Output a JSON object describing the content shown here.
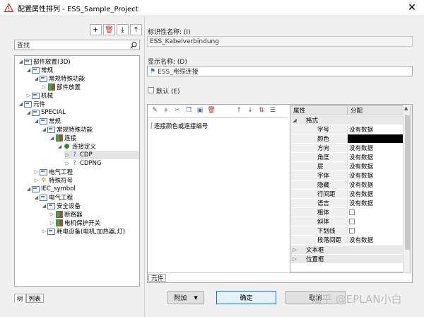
{
  "window": {
    "title": "配置属性排列 - ESS_Sample_Project",
    "close_glyph": "✕"
  },
  "left": {
    "search_placeholder": "查找",
    "tree": [
      {
        "label": "部件放置(3D)"
      },
      {
        "label": "常规"
      },
      {
        "label": "常规特殊功能"
      },
      {
        "label": "部件放置"
      },
      {
        "label": "机械"
      },
      {
        "label": "元件"
      },
      {
        "label": "SPECIAL"
      },
      {
        "label": "常规"
      },
      {
        "label": "常规特殊功能"
      },
      {
        "label": "连接"
      },
      {
        "label": "连接定义"
      },
      {
        "label": "CDP"
      },
      {
        "label": "CDPNG"
      },
      {
        "label": "电气工程"
      },
      {
        "label": "特殊符号"
      },
      {
        "label": "IEC_symbol"
      },
      {
        "label": "电气工程"
      },
      {
        "label": "安全设备"
      },
      {
        "label": "断路器"
      },
      {
        "label": "电机保护开关"
      },
      {
        "label": "耗电设备(电机,加热器,灯)"
      }
    ],
    "tabs": [
      "树",
      "列表"
    ]
  },
  "right": {
    "id_name_label": "标识性名称: (I)",
    "id_name_value": "ESS_Kabelverbindung",
    "display_name_label": "显示名称: (D)",
    "display_name_value": "ESS_电缆连接",
    "default_label": "默认 (E)",
    "list_item": "连接颜色或连接编号",
    "prop_header": "属性",
    "assign_header": "分配",
    "groups": [
      "格式",
      "文本框",
      "位置框"
    ],
    "rows": [
      {
        "k": "字号",
        "v": "没有数据"
      },
      {
        "k": "颜色",
        "v": ""
      },
      {
        "k": "方向",
        "v": "没有数据"
      },
      {
        "k": "角度",
        "v": "没有数据"
      },
      {
        "k": "层",
        "v": "没有数据"
      },
      {
        "k": "字体",
        "v": "没有数据"
      },
      {
        "k": "隐藏",
        "v": "没有数据"
      },
      {
        "k": "行间距",
        "v": "没有数据"
      },
      {
        "k": "语言",
        "v": "没有数据"
      },
      {
        "k": "粗体",
        "v": ""
      },
      {
        "k": "斜体",
        "v": ""
      },
      {
        "k": "下划线",
        "v": ""
      },
      {
        "k": "段落间距",
        "v": "没有数据"
      }
    ],
    "bottom_tab": "元件"
  },
  "buttons": {
    "add": "附加",
    "ok": "确定",
    "cancel": "取消"
  },
  "watermark": "知乎 @EPLAN小白",
  "colors": {
    "accent": "#0078d7",
    "error_icon": "#c42b1c"
  }
}
